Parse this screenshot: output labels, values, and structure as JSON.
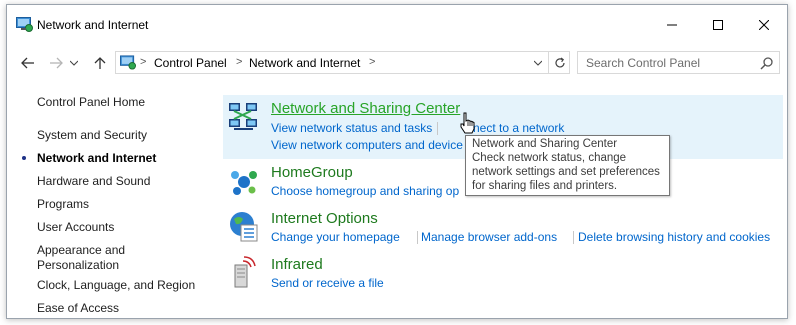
{
  "window": {
    "title": "Network and Internet",
    "icon": "control-panel-icon"
  },
  "nav": {
    "back": "back-arrow-icon",
    "forward": "forward-arrow-icon",
    "recent": "chevron-down-icon",
    "up": "up-arrow-icon"
  },
  "address": {
    "crumbs": [
      "Control Panel",
      "Network and Internet"
    ],
    "separator": ">"
  },
  "search": {
    "placeholder": "Search Control Panel"
  },
  "sidebar": {
    "items": [
      {
        "label": "Control Panel Home"
      },
      {
        "label": "System and Security"
      },
      {
        "label": "Network and Internet",
        "active": true
      },
      {
        "label": "Hardware and Sound"
      },
      {
        "label": "Programs"
      },
      {
        "label": "User Accounts"
      },
      {
        "label": "Appearance and Personalization",
        "lines": [
          "Appearance and",
          "Personalization"
        ]
      },
      {
        "label": "Clock, Language, and Region"
      },
      {
        "label": "Ease of Access"
      }
    ]
  },
  "categories": [
    {
      "title": "Network and Sharing Center",
      "icon": "network-sharing-icon",
      "links": [
        "View network status and tasks",
        "Connect to a network",
        "View network computers and devices"
      ],
      "link_partial": [
        "nect to a network",
        "View network computers and device"
      ]
    },
    {
      "title": "HomeGroup",
      "icon": "homegroup-icon",
      "links": [
        "Choose homegroup and sharing options"
      ],
      "link_partial": [
        "Choose homegroup and sharing op"
      ]
    },
    {
      "title": "Internet Options",
      "icon": "internet-options-icon",
      "links": [
        "Change your homepage",
        "Manage browser add-ons",
        "Delete browsing history and cookies"
      ]
    },
    {
      "title": "Infrared",
      "icon": "infrared-icon",
      "links": [
        "Send or receive a file"
      ]
    }
  ],
  "tooltip": {
    "lines": [
      "Network and Sharing Center",
      "Check network status, change",
      "network settings and set preferences",
      "for sharing files and printers."
    ]
  },
  "colors": {
    "link": "#0066cc",
    "category": "#1e7a1e",
    "hover_category": "#28a428",
    "highlight": "#e5f3fb",
    "bullet": "#1e3287"
  }
}
